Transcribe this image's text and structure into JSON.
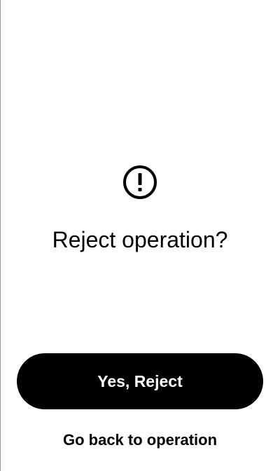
{
  "dialog": {
    "icon": "exclamation-circle-icon",
    "title": "Reject operation?",
    "confirm_label": "Yes, Reject",
    "back_label": "Go back to operation"
  },
  "colors": {
    "background": "#ffffff",
    "primary_button": "#000000",
    "primary_button_text": "#ffffff",
    "text": "#000000"
  }
}
